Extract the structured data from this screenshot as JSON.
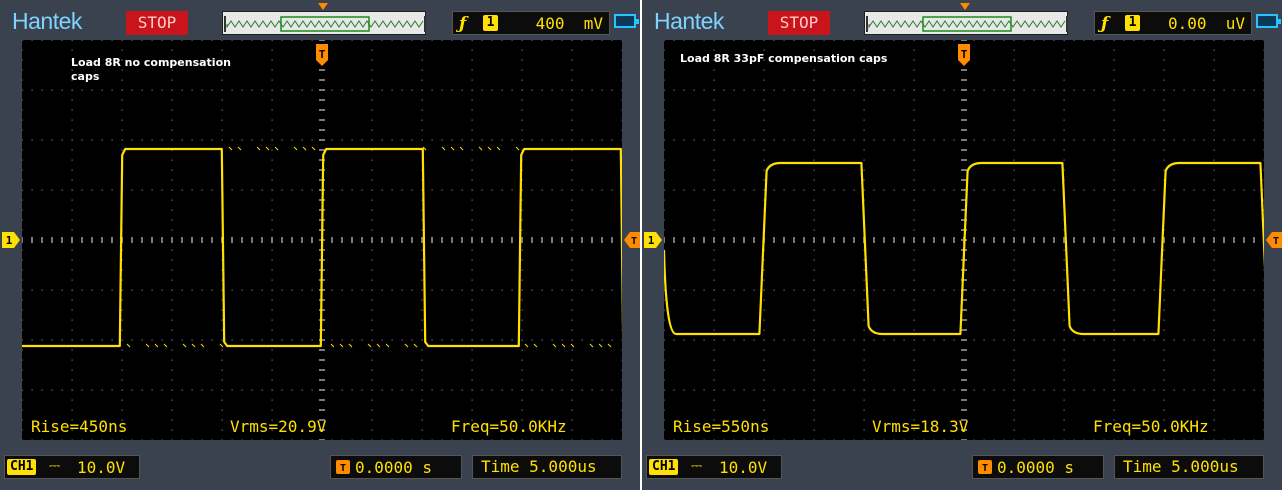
{
  "colors": {
    "trace": "#ffe000",
    "grid_dot": "#7a7a7a",
    "trigger": "#ff8c00",
    "bezel": "#3a4250",
    "stop_bg": "#c8141a"
  },
  "scopes": [
    {
      "brand": "Hantek",
      "status": "STOP",
      "trigger": {
        "edge_icon": "rising-edge-icon",
        "channel": "1",
        "level": "400  mV"
      },
      "caption": "Load 8R no compensation\ncaps",
      "measurements": {
        "rise": "Rise=450ns",
        "vrms": "Vrms=20.9V",
        "freq": "Freq=50.0KHz"
      },
      "channel": {
        "tag": "CH1",
        "coupling": "DC",
        "volts_div": "10.0V"
      },
      "trigger_position": "0.0000 s",
      "timebase": "Time 5.000us",
      "waveform": {
        "high_level": 0.455,
        "low_level": -0.53,
        "edge_times": [
          0.165,
          0.335,
          0.5,
          0.67,
          0.83,
          1.0
        ],
        "rise_fraction": 0.004,
        "overshoot": "none-sharp"
      }
    },
    {
      "brand": "Hantek",
      "status": "STOP",
      "trigger": {
        "edge_icon": "rising-edge-icon",
        "channel": "1",
        "level": "0.00  uV"
      },
      "caption": "Load 8R 33pF compensation caps",
      "measurements": {
        "rise": "Rise=550ns",
        "vrms": "Vrms=18.3V",
        "freq": "Freq=50.0KHz"
      },
      "channel": {
        "tag": "CH1",
        "coupling": "DC",
        "volts_div": "10.0V"
      },
      "trigger_position": "0.0000 s",
      "timebase": "Time 5.000us",
      "waveform": {
        "high_level": 0.385,
        "low_level": -0.47,
        "edge_times": [
          0.165,
          0.335,
          0.5,
          0.67,
          0.83,
          1.0
        ],
        "rise_fraction": 0.012,
        "overshoot": "rounded"
      }
    }
  ]
}
